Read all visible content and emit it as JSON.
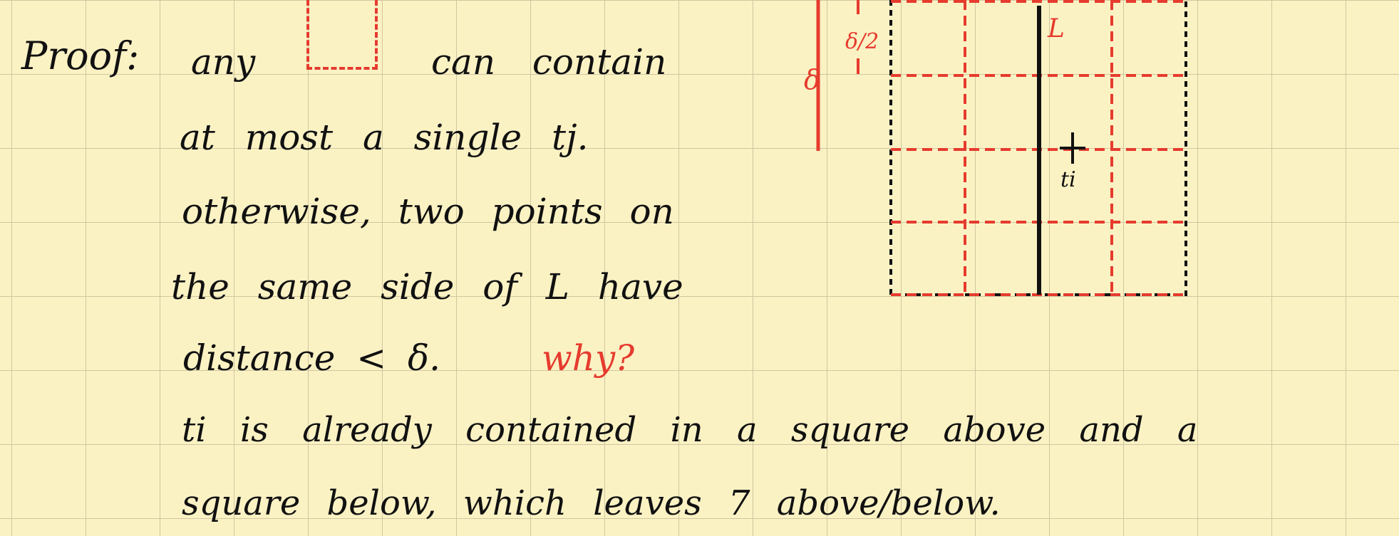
{
  "text": {
    "proof_label": "Proof:",
    "line1_a": "any",
    "line1_b": "can contain",
    "line2": "at most a single tj.",
    "line3": "otherwise, two points on",
    "line4": "the same side of L have",
    "line5": "distance < δ.",
    "why": "why?",
    "line6": "ti is already contained in a square above and a",
    "line7": "square below, which leaves 7 above/below."
  },
  "figure": {
    "line_label": "L",
    "point_label": "ti",
    "delta_label": "δ",
    "half_delta_label": "δ/2",
    "grid_columns": 4,
    "grid_rows": 4
  },
  "colors": {
    "paper": "#fbf2c4",
    "grid": "#cfc6a0",
    "ink": "#111111",
    "red_ink": "#e63b2e"
  }
}
